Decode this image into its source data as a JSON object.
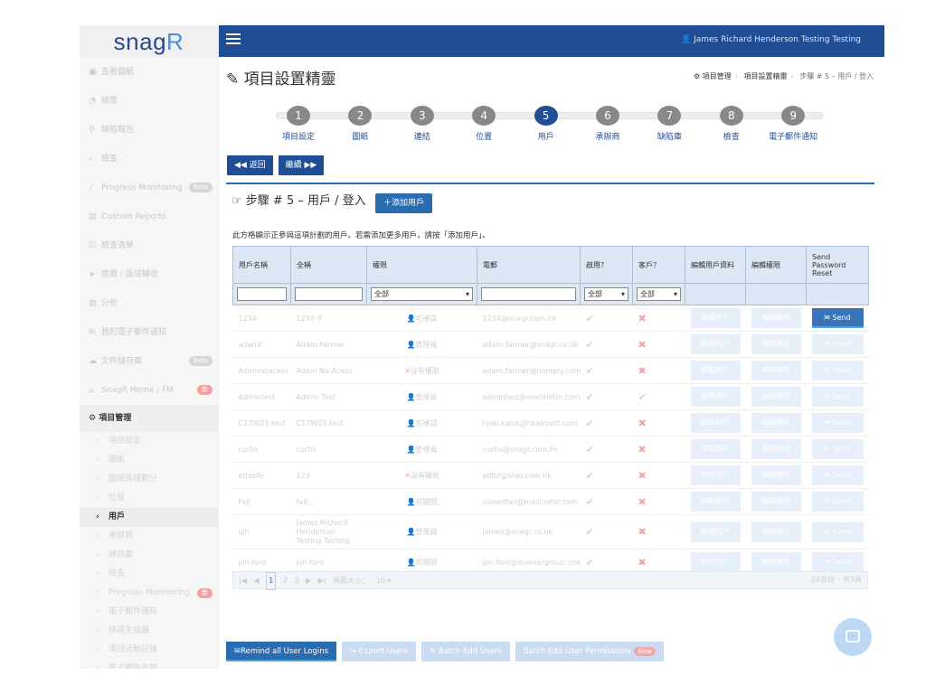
{
  "logo": {
    "text_main": "snag",
    "text_accent": "R"
  },
  "topbar": {
    "user_name": "James Richard Henderson Testing Testing"
  },
  "sidebar": {
    "items": [
      {
        "label": "查看圖紙",
        "icon": "image-icon"
      },
      {
        "label": "總覽",
        "icon": "dashboard-icon"
      },
      {
        "label": "缺陷報告",
        "icon": "pin-icon"
      },
      {
        "label": "檢查",
        "icon": "search-icon"
      },
      {
        "label": "Progress Monitoring",
        "icon": "chart-icon",
        "badge": "Beta"
      },
      {
        "label": "Custom Reports",
        "icon": "report-icon"
      },
      {
        "label": "檢查清單",
        "icon": "checklist-icon"
      },
      {
        "label": "房間 / 區域轉收",
        "icon": "send-icon"
      },
      {
        "label": "分析",
        "icon": "bar-chart-icon"
      },
      {
        "label": "我的電子郵件通知",
        "icon": "mail-icon"
      },
      {
        "label": "文件儲存庫",
        "icon": "cloud-icon",
        "badge": "Beta"
      },
      {
        "label": "SnagR Home / FM",
        "icon": "home-icon",
        "badge": "新"
      }
    ],
    "section": "項目管理",
    "subitems": [
      "項目設定",
      "圖紙",
      "圖紙區域劃分",
      "位置",
      "用戶",
      "承辦商",
      "缺陷庫",
      "檢查",
      "Progress Monitoring",
      "電子郵件通知",
      "條碼生成器",
      "項目活動記錄",
      "電子郵件追蹤"
    ],
    "active_sub": "用戶",
    "progress_badge": "新"
  },
  "page": {
    "title": "項目設置精靈"
  },
  "breadcrumb": {
    "items": [
      "項目管理",
      "項目設置精靈"
    ],
    "current": "步驟 # 5 – 用戶 / 登入"
  },
  "wizard": {
    "steps": [
      {
        "num": "1",
        "label": "項目設定"
      },
      {
        "num": "2",
        "label": "圖紙"
      },
      {
        "num": "3",
        "label": "連結"
      },
      {
        "num": "4",
        "label": "位置"
      },
      {
        "num": "5",
        "label": "用戶"
      },
      {
        "num": "6",
        "label": "承辦商"
      },
      {
        "num": "7",
        "label": "缺陷庫"
      },
      {
        "num": "8",
        "label": "檢查"
      },
      {
        "num": "9",
        "label": "電子郵件通知"
      }
    ],
    "active_step": 5
  },
  "nav": {
    "back": "返回",
    "next": "繼續"
  },
  "panel": {
    "title": "步驟 # 5 – 用戶 / 登入",
    "add_user": "添加用戶",
    "description": "此方格顯示正參與這項計劃的用戶。若需添加更多用戶，請按「添加用戶」。"
  },
  "table": {
    "headers": [
      "用戶名稱",
      "全稱",
      "權限",
      "電郵",
      "啟用？",
      "客戶？",
      "編輯用戶資料",
      "編輯權限",
      "Send Password Reset"
    ],
    "filter_all": "全部",
    "edit_user": "編輯用戶",
    "edit_perm": "編輯權限",
    "send": "Send",
    "rows": [
      {
        "username": "1234",
        "fullname": "1234-9",
        "perm": "可確認",
        "perm_type": "user",
        "email": "1234@snagr.com.hk",
        "enabled": true,
        "client": false
      },
      {
        "username": "adamf",
        "fullname": "Adam Farmer",
        "perm": "管理員",
        "perm_type": "user",
        "email": "adam.farmer@snagr.co.uk",
        "enabled": true,
        "client": false
      },
      {
        "username": "Adamnoacess",
        "fullname": "Adam No Acess",
        "perm": "沒有權限",
        "perm_type": "none",
        "email": "adam.farmer@noreply.com",
        "enabled": true,
        "client": false
      },
      {
        "username": "Admintest",
        "fullname": "Admin Test",
        "perm": "管理員",
        "perm_type": "user",
        "email": "admintest@mailinator.com",
        "enabled": true,
        "client": true
      },
      {
        "username": "C17W03.test",
        "fullname": "C17W03.test",
        "perm": "可確認",
        "perm_type": "user",
        "email": "ryan.kwok@hkairport.com",
        "enabled": true,
        "client": false
      },
      {
        "username": "curtis",
        "fullname": "curtis",
        "perm": "管理員",
        "perm_type": "user",
        "email": "curtis@snagr.com.hk",
        "enabled": true,
        "client": false
      },
      {
        "username": "ettesfe",
        "fullname": "123",
        "perm": "沒有權限",
        "perm_type": "none",
        "email": "edfsf@snar.com.hk",
        "enabled": true,
        "client": false
      },
      {
        "username": "Fail",
        "fullname": "fail, ,",
        "perm": "可關閉",
        "perm_type": "user",
        "email": "closedfail@mailinator.com",
        "enabled": true,
        "client": false
      },
      {
        "username": "gjh",
        "fullname": "James Richard Henderson Testing Testing",
        "perm": "管理員",
        "perm_type": "user",
        "email": "james@snagr.co.uk",
        "enabled": true,
        "client": false
      },
      {
        "username": "jon.ford",
        "fullname": "jon.ford",
        "perm": "可關閉",
        "perm_type": "user",
        "email": "jon.ford@downergroup.com",
        "enabled": true,
        "client": false
      }
    ]
  },
  "pager": {
    "pages": [
      "1",
      "2",
      "3"
    ],
    "page_size_label": "頁面大小：",
    "page_size": "10",
    "summary": "24項目 – 共3頁"
  },
  "bottom": {
    "remind": "Remind all User Logins",
    "export": "Export Users",
    "batch_edit": "Batch Edit Users",
    "batch_perm": "Batch Edit User Permissions",
    "new_badge": "New"
  },
  "colors": {
    "brand": "#1f4e95",
    "accent": "#2a6cb0"
  }
}
